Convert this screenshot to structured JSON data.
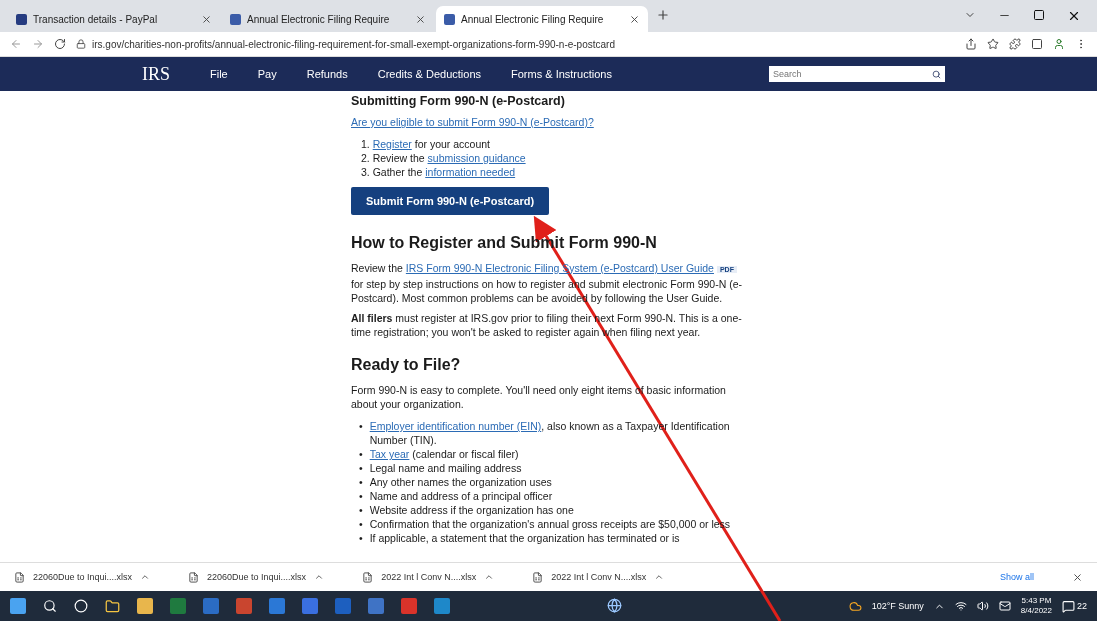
{
  "browser": {
    "tabs": [
      {
        "label": "Transaction details - PayPal",
        "selected": false
      },
      {
        "label": "Annual Electronic Filing Require",
        "selected": false
      },
      {
        "label": "Annual Electronic Filing Require",
        "selected": true
      }
    ],
    "url": "irs.gov/charities-non-profits/annual-electronic-filing-requirement-for-small-exempt-organizations-form-990-n-e-postcard"
  },
  "site_nav": {
    "logo": "IRS",
    "items": [
      "File",
      "Pay",
      "Refunds",
      "Credits & Deductions",
      "Forms & Instructions"
    ],
    "search": {
      "placeholder": "Search"
    }
  },
  "content": {
    "heading": "Submitting Form 990-N (e-Postcard)",
    "eligibility_link": "Are you eligible to submit Form 990-N (e-Postcard)?",
    "steps": [
      {
        "number": "1.",
        "link": "Register",
        "after": " for your account"
      },
      {
        "number": "2.",
        "before": "Review the ",
        "link": "submission guidance"
      },
      {
        "number": "3.",
        "before": "Gather the ",
        "link": "information needed"
      }
    ],
    "submit_button": "Submit Form 990-N (e-Postcard)",
    "register_heading": "How to Register and Submit Form 990-N",
    "guide_paragraph": {
      "before": "Review the ",
      "link": "IRS Form 990-N Electronic Filing System (e-Postcard) User Guide",
      "badge": "PDF",
      "after": " for step by step instructions on how to register and submit electronic Form 990-N (e-Postcard). Most common problems can be avoided by following the User Guide."
    },
    "filers_paragraph": "**All filers** must register at IRS.gov prior to filing their next Form 990-N. This is a one-time registration; you won't be asked to register again when filing next year.",
    "ready_heading": "Ready to File?",
    "ready_paragraph": "Form 990-N is easy to complete. You'll need only eight items of basic information about your organization.",
    "items": [
      {
        "bullet": "•",
        "link": "Employer identification number (EIN)",
        "text": ", also known as a Taxpayer Identification Number (TIN)."
      },
      {
        "bullet": "•",
        "link": "Tax year",
        "text": " (calendar or fiscal filer)"
      },
      {
        "bullet": "•",
        "text": "Legal name and mailing address"
      },
      {
        "bullet": "•",
        "text": "Any other names the organization uses"
      },
      {
        "bullet": "•",
        "text": "Name and address of a principal officer"
      },
      {
        "bullet": "•",
        "text": "Website address if the organization has one"
      },
      {
        "bullet": "•",
        "text": "Confirmation that the organization's annual gross receipts are $50,000 or less"
      },
      {
        "bullet": "•",
        "text": "If applicable, a statement that the organization has terminated or is"
      }
    ]
  },
  "downloads": {
    "files": [
      "22060Due to Inqui....xlsx",
      "22060Due to Inqui....xlsx",
      "2022 Int l Conv N....xlsx",
      "2022 Int l Conv N....xlsx"
    ],
    "show_all": "Show all"
  },
  "taskbar": {
    "weather": "102°F Sunny",
    "time": "5:43 PM",
    "date": "8/4/2022",
    "notifications": "22"
  }
}
